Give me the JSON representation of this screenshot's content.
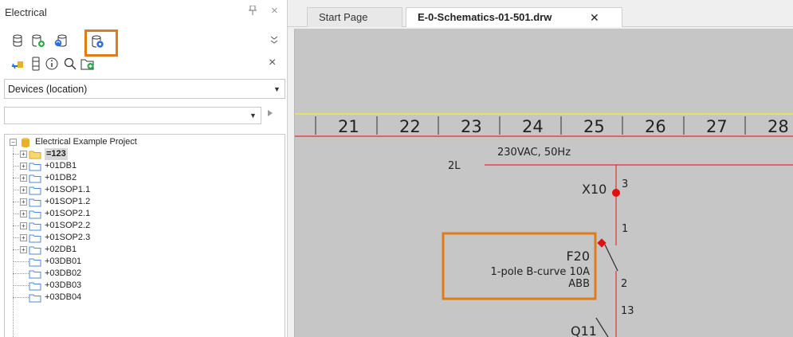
{
  "panel": {
    "title": "Electrical",
    "pin_glyph": "□",
    "close_glyph": "×",
    "collapse_glyph": "‸",
    "toolbar_close_glyph": "×",
    "location_dropdown": {
      "value": "Devices (location)"
    },
    "search": {
      "value": "",
      "placeholder": ""
    }
  },
  "tree": {
    "root": "Electrical Example Project",
    "items": [
      "=123",
      "+01DB1",
      "+01DB2",
      "+01SOP1.1",
      "+01SOP1.2",
      "+01SOP2.1",
      "+01SOP2.2",
      "+01SOP2.3",
      "+02DB1",
      "+03DB01",
      "+03DB02",
      "+03DB03",
      "+03DB04"
    ]
  },
  "tabs": {
    "start": "Start Page",
    "drawing": "E-0-Schematics-01-501.drw",
    "close_glyph": "✕"
  },
  "schematic": {
    "columns": [
      "21",
      "22",
      "23",
      "24",
      "25",
      "26",
      "27",
      "28"
    ],
    "supply_label": "2L",
    "supply_desc": "230VAC, 50Hz",
    "terminal_tag": "X10",
    "terminal_num": "3",
    "pin_1": "1",
    "breaker_tag": "F20",
    "breaker_desc": "1-pole B-curve 10A",
    "breaker_maker": "ABB",
    "pin_2": "2",
    "pin_13": "13",
    "next_tag": "Q11"
  },
  "colors": {
    "highlight": "#e07b1a",
    "wire": "#e03030",
    "folder": "#4f8bd6",
    "root_db": "#e8b12a",
    "accent_green": "#2eaa4a"
  }
}
